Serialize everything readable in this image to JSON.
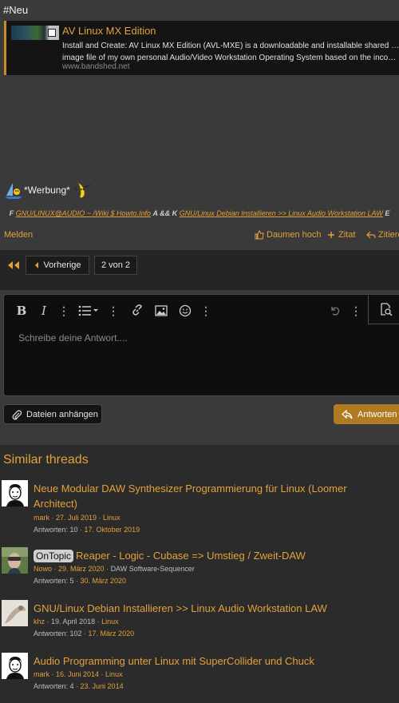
{
  "post": {
    "hashtag": "#Neu",
    "embed": {
      "title": "AV Linux MX Edition",
      "desc_line1": "Install and Create: AV Linux MX Edition (AVL-MXE) is a downloadable and installable shared snapshot ISO",
      "desc_line2": "image file of my own personal Audio/Video Workstation Operating System based on the incompara...",
      "url": "www.bandshed.net"
    },
    "werbung": "*Werbung*",
    "signature": {
      "prefix": "F",
      "link1": "GNU/LINUX@AUDIO ~ /Wiki $ Howto.Info",
      "mid": "A && K",
      "link2": "GNU/Linux Debian Installieren >> Linux Audio Workstation LAW",
      "suffix": "E"
    },
    "actions": {
      "report": "Melden",
      "like": "Daumen hoch",
      "quote": "Zitat",
      "reply": "Zitieren"
    }
  },
  "pager": {
    "prev": "Vorherige",
    "page": "2 von 2"
  },
  "editor": {
    "placeholder": "Schreibe deine Antwort....",
    "attach": "Dateien anhängen",
    "submit": "Antworten"
  },
  "similar": {
    "title": "Similar threads",
    "threads": [
      {
        "title": "Neue Modular DAW Synthesizer Programmierung für Linux (Loomer Architect)",
        "author": "mark",
        "date": "27. Juli 2019",
        "forum": "Linux",
        "replies": "Antworten: 10",
        "last": "17. Oktober 2019"
      },
      {
        "prefix": "OnTopic",
        "title": "Reaper - Logic - Cubase => Umstieg / Zweit-DAW",
        "author": "Nowo",
        "date": "29. März 2020",
        "forum": "DAW Software-Sequencer",
        "replies": "Antworten: 5",
        "last": "30. März 2020"
      },
      {
        "title": "GNU/Linux Debian Installieren >> Linux Audio Workstation LAW",
        "author": "khz",
        "date": "19. April 2018",
        "forum": "Linux",
        "replies": "Antworten: 102",
        "last": "17. März 2020"
      },
      {
        "title": "Audio Programming unter Linux mit SuperCollider und Chuck",
        "author": "mark",
        "date": "16. Juni 2014",
        "forum": "Linux",
        "replies": "Antworten: 4",
        "last": "23. Juni 2014"
      }
    ]
  },
  "colors": {
    "accent": "#e3a13c",
    "button": "#b07a22",
    "bg": "#3a3a3a"
  }
}
